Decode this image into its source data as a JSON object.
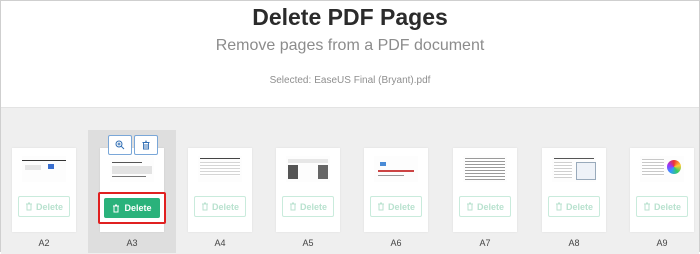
{
  "header": {
    "title": "Delete PDF Pages",
    "subtitle": "Remove pages from a PDF document",
    "selected_label": "Selected:",
    "selected_file": "EaseUS Final (Bryant).pdf"
  },
  "tools": {
    "zoom_icon": "zoom-in-icon",
    "trash_icon": "trash-icon"
  },
  "pages": [
    {
      "label": "A2",
      "delete_label": "Delete",
      "selected": false
    },
    {
      "label": "A3",
      "delete_label": "Delete",
      "selected": true
    },
    {
      "label": "A4",
      "delete_label": "Delete",
      "selected": false
    },
    {
      "label": "A5",
      "delete_label": "Delete",
      "selected": false
    },
    {
      "label": "A6",
      "delete_label": "Delete",
      "selected": false
    },
    {
      "label": "A7",
      "delete_label": "Delete",
      "selected": false
    },
    {
      "label": "A8",
      "delete_label": "Delete",
      "selected": false
    },
    {
      "label": "A9",
      "delete_label": "Delete",
      "selected": false
    }
  ],
  "colors": {
    "accent": "#2ab27b",
    "highlight": "#e02020",
    "tool_border": "#7aa7d8"
  }
}
